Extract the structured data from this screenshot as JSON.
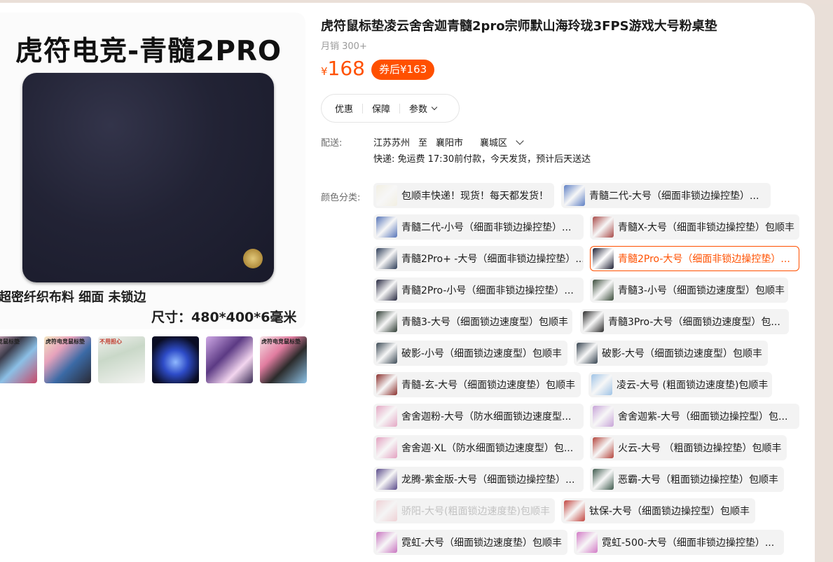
{
  "main_image": {
    "title": "虎符电竞-青髓2PRO",
    "sub1": "超密纤织布料  细面 未锁边",
    "sub2": "尺寸：480*400*6毫米"
  },
  "thumbnails": [
    {
      "caption": "电竞鼠标垫"
    },
    {
      "caption": "虎符电竞鼠标垫"
    },
    {
      "caption": "不用担心"
    },
    {
      "caption": ""
    },
    {
      "caption": ""
    },
    {
      "caption": "虎符电竞鼠标垫"
    }
  ],
  "product": {
    "title": "虎符鼠标垫凌云舍舍迦青髓2pro宗师默山海玲珑3FPS游戏大号粉桌垫",
    "sales": "月销 300+",
    "currency": "¥",
    "price": "168",
    "coupon": "券后¥163"
  },
  "tabs": {
    "discount": "优惠",
    "guarantee": "保障",
    "params": "参数"
  },
  "shipping": {
    "label": "配送:",
    "from": "江苏苏州",
    "to_word": "至",
    "city": "襄阳市",
    "district": "襄城区",
    "info": "快递: 免运费  17:30前付款，今天发货，预计后天送达"
  },
  "color_label": "颜色分类:",
  "options": [
    {
      "label": "包顺丰快递！现货！每天都发货！",
      "swatch": "#f2efe2"
    },
    {
      "label": "青髓二代-大号（细面非锁边操控垫）...",
      "swatch": "#5d7fc4"
    },
    {
      "label": "青髓二代-小号（细面非锁边操控垫）...",
      "swatch": "#5674b8"
    },
    {
      "label": "青髓X-大号（细面非锁边操控垫）包顺丰",
      "swatch": "#a84a48"
    },
    {
      "label": "青髓2Pro+ -大号（细面非锁边操控垫）...",
      "swatch": "#2d3d58"
    },
    {
      "label": "青髓2Pro-大号（细面非锁边操控垫）...",
      "swatch": "#1d1f33"
    },
    {
      "label": "青髓2Pro-小号（细面非锁边操控垫）...",
      "swatch": "#262840"
    },
    {
      "label": "青髓3-小号（细面锁边速度型）包顺丰",
      "swatch": "#3a4c3a"
    },
    {
      "label": "青髓3-大号（细面锁边速度型）包顺丰",
      "swatch": "#2f3d34"
    },
    {
      "label": "青髓3Pro-大号（细面锁边速度型）包...",
      "swatch": "#2a2a2a"
    },
    {
      "label": "破影-小号（细面锁边速度型）包顺丰",
      "swatch": "#3c4a55"
    },
    {
      "label": "破影-大号（细面锁边速度型）包顺丰",
      "swatch": "#34424e"
    },
    {
      "label": "青髓-玄-大号（细面锁边速度垫）包顺丰",
      "swatch": "#8a2f2c"
    },
    {
      "label": "凌云-大号 (粗面锁边速度垫)包顺丰",
      "swatch": "#9ec3e6"
    },
    {
      "label": "舍舍迦粉-大号（防水细面锁边速度型...",
      "swatch": "#e4a7c4"
    },
    {
      "label": "舍舍迦紫-大号（细面锁边操控型）包...",
      "swatch": "#c7a3d8"
    },
    {
      "label": "舍舍迦·XL（防水细面锁边速度型）包...",
      "swatch": "#e3a0c0"
    },
    {
      "label": "火云-大号 （粗面锁边操控垫）包顺丰",
      "swatch": "#b4453c"
    },
    {
      "label": "龙腾-紫金版-大号（细面锁边操控垫）...",
      "swatch": "#5a4b8a"
    },
    {
      "label": "恶霸-大号（粗面锁边操控垫）包顺丰",
      "swatch": "#3e5a4d"
    },
    {
      "label": "骄阳-大号(粗面锁边速度垫)包顺丰",
      "swatch": "#e9a7b0"
    },
    {
      "label": "钛保-大号（细面锁边操控型）包顺丰",
      "swatch": "#c2453f"
    },
    {
      "label": "霓虹-大号（细面锁边速度垫）包顺丰",
      "swatch": "#c874c0"
    },
    {
      "label": "霓虹-500-大号（细面非锁边操控垫）...",
      "swatch": "#d27ac6"
    }
  ],
  "selected_option_index": 5,
  "disabled_option_index": 20,
  "colors": {
    "accent": "#ff5000",
    "chip_bg": "#f3f3f3",
    "page_bg": "#e9dfd8"
  }
}
